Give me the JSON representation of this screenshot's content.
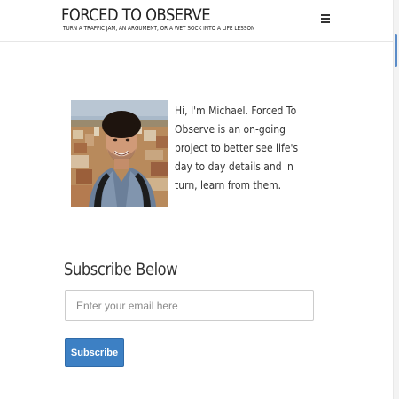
{
  "header": {
    "title": "FORCED TO OBSERVE",
    "tagline": "TURN A TRAFFIC JAM, AN ARGUMENT, OR A WET SOCK INTO A LIFE LESSON",
    "menu_icon": "hamburger-menu-icon"
  },
  "intro": {
    "photo_icon": "profile-photo",
    "text": "Hi, I'm Michael. Forced To Observe is an on-going project to better see life's day to day details and in turn, learn from them."
  },
  "subscribe": {
    "heading": "Subscribe Below",
    "email_placeholder": "Enter your email here",
    "email_value": "",
    "button_label": "Subscribe"
  },
  "colors": {
    "accent": "#3d80c4",
    "text": "#333333",
    "scrollbar_thumb": "#5b8cc8"
  }
}
